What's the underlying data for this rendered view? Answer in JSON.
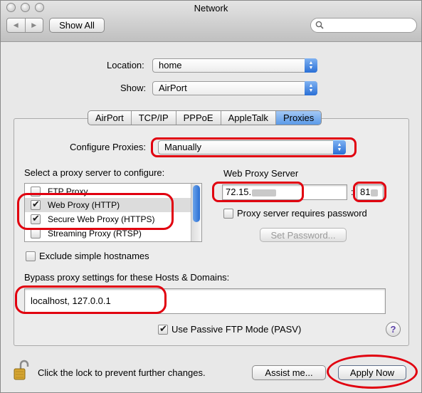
{
  "window": {
    "title": "Network"
  },
  "toolbar": {
    "back_glyph": "◀",
    "forward_glyph": "▶",
    "show_all_label": "Show All",
    "search_placeholder": ""
  },
  "location": {
    "label": "Location:",
    "value": "home"
  },
  "show": {
    "label": "Show:",
    "value": "AirPort"
  },
  "tabs": [
    {
      "label": "AirPort",
      "selected": false
    },
    {
      "label": "TCP/IP",
      "selected": false
    },
    {
      "label": "PPPoE",
      "selected": false
    },
    {
      "label": "AppleTalk",
      "selected": false
    },
    {
      "label": "Proxies",
      "selected": true
    }
  ],
  "proxies": {
    "configure_label": "Configure Proxies:",
    "configure_value": "Manually",
    "select_label": "Select a proxy server to configure:",
    "list": [
      {
        "label": "FTP Proxy",
        "checked": false
      },
      {
        "label": "Web Proxy (HTTP)",
        "checked": true
      },
      {
        "label": "Secure Web Proxy (HTTPS)",
        "checked": true
      },
      {
        "label": "Streaming Proxy (RTSP)",
        "checked": false
      }
    ],
    "server_label": "Web Proxy Server",
    "server_value": "72.15.",
    "port_separator": ":",
    "port_value": "81",
    "requires_password_label": "Proxy server requires password",
    "set_password_label": "Set Password...",
    "exclude_label": "Exclude simple hostnames",
    "bypass_label": "Bypass proxy settings for these Hosts & Domains:",
    "bypass_value": "localhost, 127.0.0.1",
    "passive_ftp_label": "Use Passive FTP Mode (PASV)",
    "help_glyph": "?"
  },
  "footer": {
    "lock_text": "Click the lock to prevent further changes.",
    "assist_label": "Assist me...",
    "apply_label": "Apply Now"
  },
  "colors": {
    "annotation_red": "#e1000f",
    "selection_blue": "#5b9ae8"
  }
}
